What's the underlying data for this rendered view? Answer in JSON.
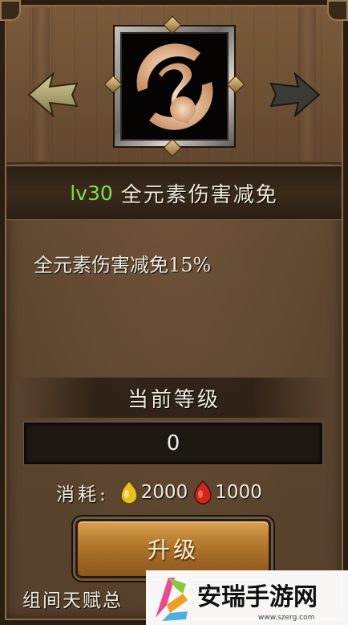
{
  "skill": {
    "level_text": "lv30",
    "name": "全元素伤害减免",
    "description": "全元素伤害减免15%",
    "icon": "swirl-element-icon"
  },
  "navigation": {
    "prev_icon": "arrow-left-icon",
    "next_icon": "arrow-right-icon"
  },
  "current_level": {
    "label": "当前等级",
    "value": "0"
  },
  "cost": {
    "label": "消耗:",
    "items": [
      {
        "icon": "yellow-gem-icon",
        "amount": "2000",
        "color": "#e8c020"
      },
      {
        "icon": "red-gem-icon",
        "amount": "1000",
        "color": "#d0281c"
      }
    ]
  },
  "actions": {
    "upgrade_label": "升级"
  },
  "footer": {
    "group_talent_text": "组间天赋总"
  },
  "watermark": {
    "text": "安瑞手游网",
    "url": "www.szerg.com"
  },
  "colors": {
    "level_green": "#7fe04a",
    "panel_brown": "#5e4630",
    "button_gold": "#b0762c"
  }
}
